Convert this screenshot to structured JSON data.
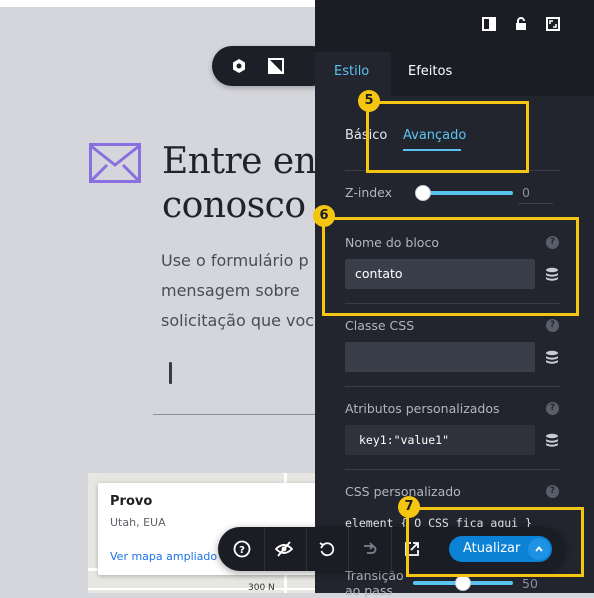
{
  "canvas": {
    "headline": "Entre em\nconosco",
    "headline_line1": "Entre en",
    "headline_line2": "conosco",
    "paragraph_lines": [
      "Use o formulário p",
      "mensagem sobre",
      "solicitação que voc"
    ],
    "map": {
      "title": "Provo",
      "subtitle": "Utah, EUA",
      "link": "Ver mapa ampliado",
      "street": "300 N"
    }
  },
  "panel": {
    "tabs": {
      "style": "Estilo",
      "effects": "Efeitos"
    },
    "subtabs": {
      "basic": "Básico",
      "advanced": "Avançado"
    },
    "zindex": {
      "label": "Z-index",
      "value": "0",
      "fraction": 0.0
    },
    "block_name": {
      "label": "Nome do bloco",
      "value": "contato"
    },
    "css_class": {
      "label": "Classe CSS",
      "value": ""
    },
    "custom_attrs": {
      "label": "Atributos personalizados",
      "value": "key1:\"value1\""
    },
    "custom_css": {
      "label": "CSS personalizado",
      "value": "element { O CSS fica aqui }"
    },
    "transition": {
      "label_line1": "Transição",
      "label_line2": "ao pass",
      "value": "50",
      "fraction": 0.5
    },
    "help_glyph": "?"
  },
  "annotations": {
    "five": "5",
    "six": "6",
    "seven": "7"
  },
  "bottom_bar": {
    "update_label": "Atualizar"
  },
  "colors": {
    "accent": "#5bc3ef",
    "panel_bg": "#22252e",
    "annotation": "#f4c612",
    "update_button": "#0b82d6",
    "envelope": "#8a6fe0"
  }
}
